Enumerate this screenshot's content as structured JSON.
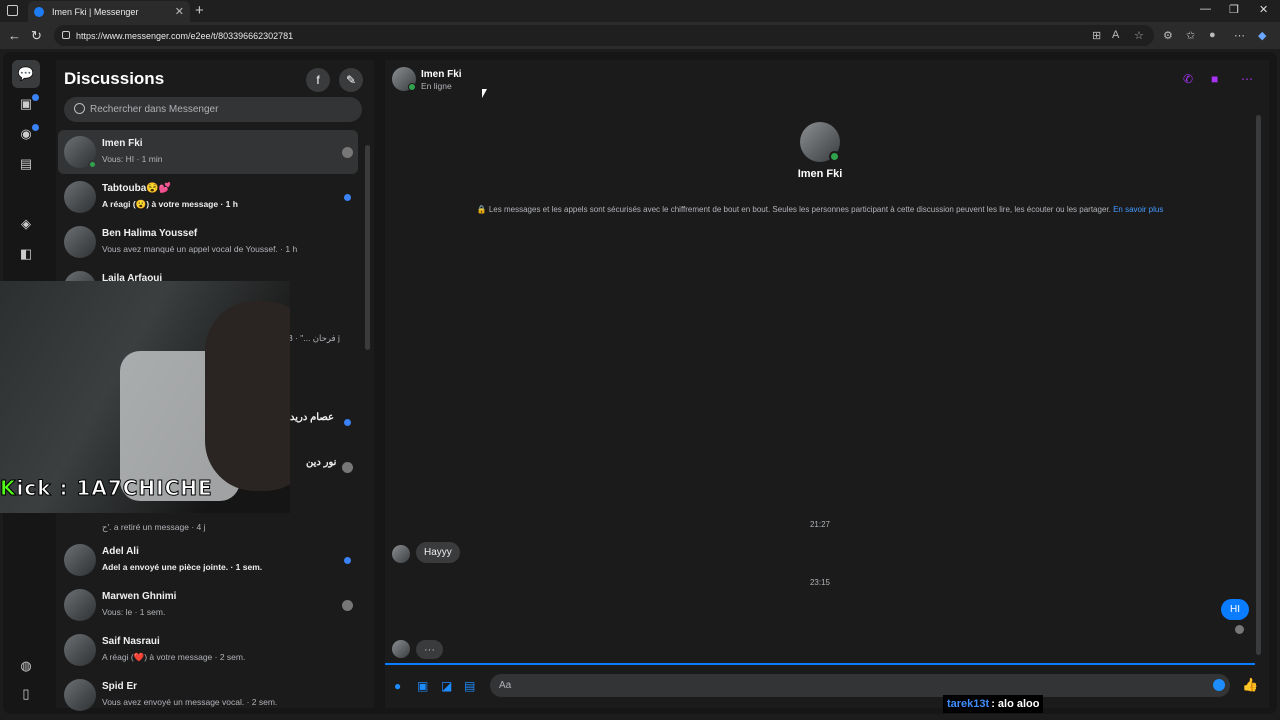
{
  "browser": {
    "tab_title": "Imen Fki | Messenger",
    "tab_close": "✕",
    "new_tab": "+",
    "url": "https://www.messenger.com/e2ee/t/803396662302781"
  },
  "sidebar": {
    "title": "Discussions",
    "search_placeholder": "Rechercher dans Messenger",
    "conversations": [
      {
        "name": "Imen Fki",
        "preview": "Vous: HI · 1 min"
      },
      {
        "name": "Tabtouba😵💕",
        "preview": "A réagi (😮) à votre message · 1 h"
      },
      {
        "name": "Ben Halima Youssef",
        "preview": "Vous avez manqué un appel vocal de Youssef. · 1 h"
      },
      {
        "name": "Laila Arfaoui",
        "preview": ""
      },
      {
        "name": "",
        "preview": "فرحان ...\" · 3 j"
      },
      {
        "name": "عصام دريد",
        "preview": ""
      },
      {
        "name": "نور دين",
        "preview": ""
      },
      {
        "name": "",
        "preview": "ح'. a retiré un message · 4 j"
      },
      {
        "name": "Adel Ali",
        "preview": "Adel a envoyé une pièce jointe. · 1 sem."
      },
      {
        "name": "Marwen Ghnimi",
        "preview": "Vous: le · 1 sem."
      },
      {
        "name": "Saif Nasraui",
        "preview": "A réagi (❤️) à votre message · 2 sem."
      },
      {
        "name": "Spid Er",
        "preview": "Vous avez envoyé un message vocal. · 2 sem."
      }
    ]
  },
  "chat": {
    "contact_name": "Imen Fki",
    "status": "En ligne",
    "e2e_notice": "🔒 Les messages et les appels sont sécurisés avec le chiffrement de bout en bout. Seules les personnes participant à cette discussion peuvent les lire, les écouter ou les partager.",
    "e2e_link": "En savoir plus",
    "timestamp_1": "21:27",
    "message_in": "Hayyy",
    "timestamp_2": "23:15",
    "message_out": "HI",
    "typing": "···",
    "composer_placeholder": "Aa"
  },
  "stream_overlay": {
    "kick_prefix": "K",
    "kick_text": "ick : 1A7CHICHE",
    "chat_user": "tarek13t",
    "chat_text": ": alo aloo"
  },
  "icons": {
    "accent": "#0a7cff",
    "call_color": "#a832f5"
  }
}
